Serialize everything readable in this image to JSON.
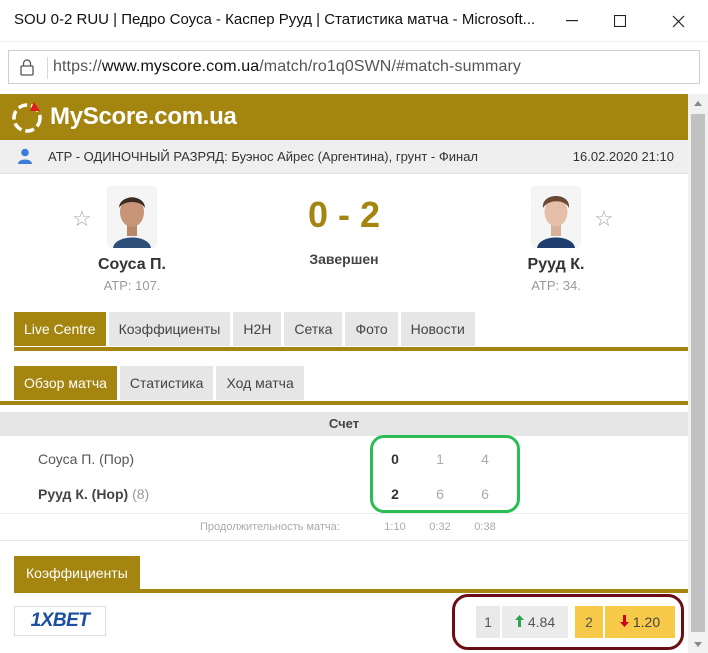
{
  "window": {
    "title": "SOU 0-2 RUU | Педро Соуса - Каспер Рууд | Статистика матча - Microsoft..."
  },
  "address": {
    "url_prefix": "https://",
    "url_host": "www.myscore.com.ua",
    "url_path": "/match/ro1q0SWN/#match-summary"
  },
  "brand": {
    "name": "MyScore.com.ua",
    "color": "#a38510"
  },
  "tournament": {
    "name": "ATP - ОДИНОЧНЫЙ РАЗРЯД: Буэнос Айрес (Аргентина), грунт - Финал",
    "datetime": "16.02.2020 21:10"
  },
  "match": {
    "home": {
      "name": "Соуса П.",
      "rank": "ATP: 107."
    },
    "away": {
      "name": "Рууд К.",
      "rank": "ATP: 34."
    },
    "score": "0 - 2",
    "status": "Завершен"
  },
  "tabs_main": [
    "Live Centre",
    "Коэффициенты",
    "H2H",
    "Сетка",
    "Фото",
    "Новости"
  ],
  "tabs_sub": [
    "Обзор матча",
    "Статистика",
    "Ход матча"
  ],
  "scoreboard": {
    "header": "Счет",
    "rows": [
      {
        "name": "Соуса П. (Пор)",
        "seed": "",
        "bold": false,
        "sets": "0",
        "s1": "1",
        "s2": "4"
      },
      {
        "name": "Рууд К. (Нор)",
        "seed": "(8)",
        "bold": true,
        "sets": "2",
        "s1": "6",
        "s2": "6"
      }
    ],
    "duration_label": "Продолжительность матча:",
    "durations": [
      "1:10",
      "0:32",
      "0:38"
    ]
  },
  "odds": {
    "tab_label": "Коэффициенты",
    "bookmaker": "1XBET",
    "items": [
      {
        "label": "1",
        "value": "4.84",
        "trend": "up"
      },
      {
        "label": "2",
        "value": "1.20",
        "trend": "down"
      }
    ]
  },
  "colors": {
    "highlight_green": "#2bbd55",
    "highlight_red": "#6b0d16",
    "odd_up": "#2ea44f",
    "odd_down": "#d0021b",
    "odd_selected": "#f7c948"
  }
}
